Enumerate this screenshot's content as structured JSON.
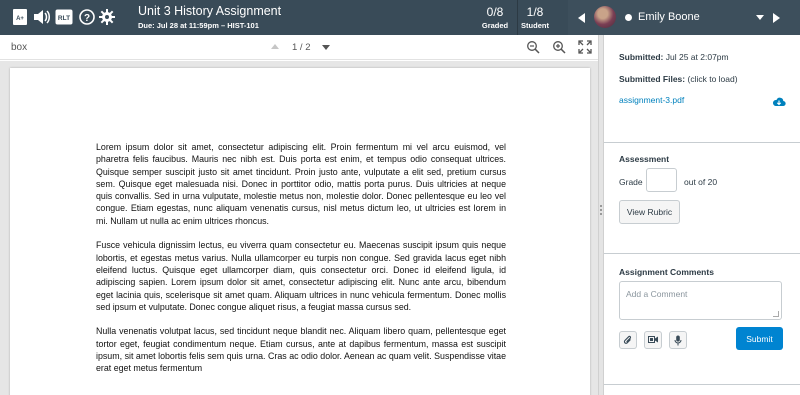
{
  "topbar": {
    "title": "Unit 3 History Assignment",
    "due": "Due: Jul 28 at 11:59pm – HIST-101",
    "graded_count": "0/8",
    "graded_label": "Graded",
    "student_count": "1/8",
    "student_label": "Student",
    "rtl_label": "RLT",
    "student_name": "Emily Boone",
    "icons": [
      "grading-icon",
      "speaker-icon",
      "rlt-icon",
      "help-icon",
      "gear-icon"
    ]
  },
  "document": {
    "name": "box",
    "page_indicator": "1 / 2",
    "paragraphs": [
      "Lorem ipsum dolor sit amet, consectetur adipiscing elit. Proin fermentum mi vel arcu euismod, vel pharetra felis faucibus. Mauris nec nibh est. Duis porta est enim, et tempus odio consequat ultrices. Quisque semper suscipit justo sit amet tincidunt. Proin justo ante, vulputate a elit sed, pretium cursus sem. Quisque eget malesuada nisi. Donec in porttitor odio, mattis porta purus. Duis ultricies at neque quis convallis. Sed in urna vulputate, molestie metus non, molestie dolor. Donec pellentesque eu leo vel congue. Etiam egestas, nunc aliquam venenatis cursus, nisl metus dictum leo, ut ultricies est lorem in mi. Nullam ut nulla ac enim ultrices rhoncus.",
      "Fusce vehicula dignissim lectus, eu viverra quam consectetur eu. Maecenas suscipit ipsum quis neque lobortis, et egestas metus varius. Nulla ullamcorper eu turpis non congue. Sed gravida lacus eget nibh eleifend luctus. Quisque eget ullamcorper diam, quis consectetur orci. Donec id eleifend ligula, id adipiscing sapien. Lorem ipsum dolor sit amet, consectetur adipiscing elit. Nunc ante arcu, bibendum eget lacinia quis, scelerisque sit amet quam. Aliquam ultrices in nunc vehicula fermentum. Donec mollis sed ipsum et vulputate. Donec congue aliquet risus, a feugiat massa cursus sed.",
      "Nulla venenatis volutpat lacus, sed tincidunt neque blandit nec. Aliquam libero quam, pellentesque eget tortor eget, feugiat condimentum neque. Etiam cursus, ante at dapibus fermentum, massa est suscipit ipsum, sit amet lobortis felis sem quis urna. Cras ac odio dolor. Aenean ac quam velit. Suspendisse vitae erat eget metus fermentum"
    ]
  },
  "panel": {
    "submitted_label": "Submitted:",
    "submitted_date": "Jul 25 at 2:07pm",
    "files_label": "Submitted Files:",
    "files_hint": "(click to load)",
    "file_name": "assignment-3.pdf",
    "assessment_title": "Assessment",
    "grade_label": "Grade",
    "grade_value": "",
    "out_of": "out of 20",
    "view_rubric": "View Rubric",
    "comments_title": "Assignment Comments",
    "comment_placeholder": "Add a Comment",
    "submit": "Submit"
  },
  "colors": {
    "topbar": "#394b58",
    "link": "#0081bd",
    "submit": "#0084d1"
  }
}
